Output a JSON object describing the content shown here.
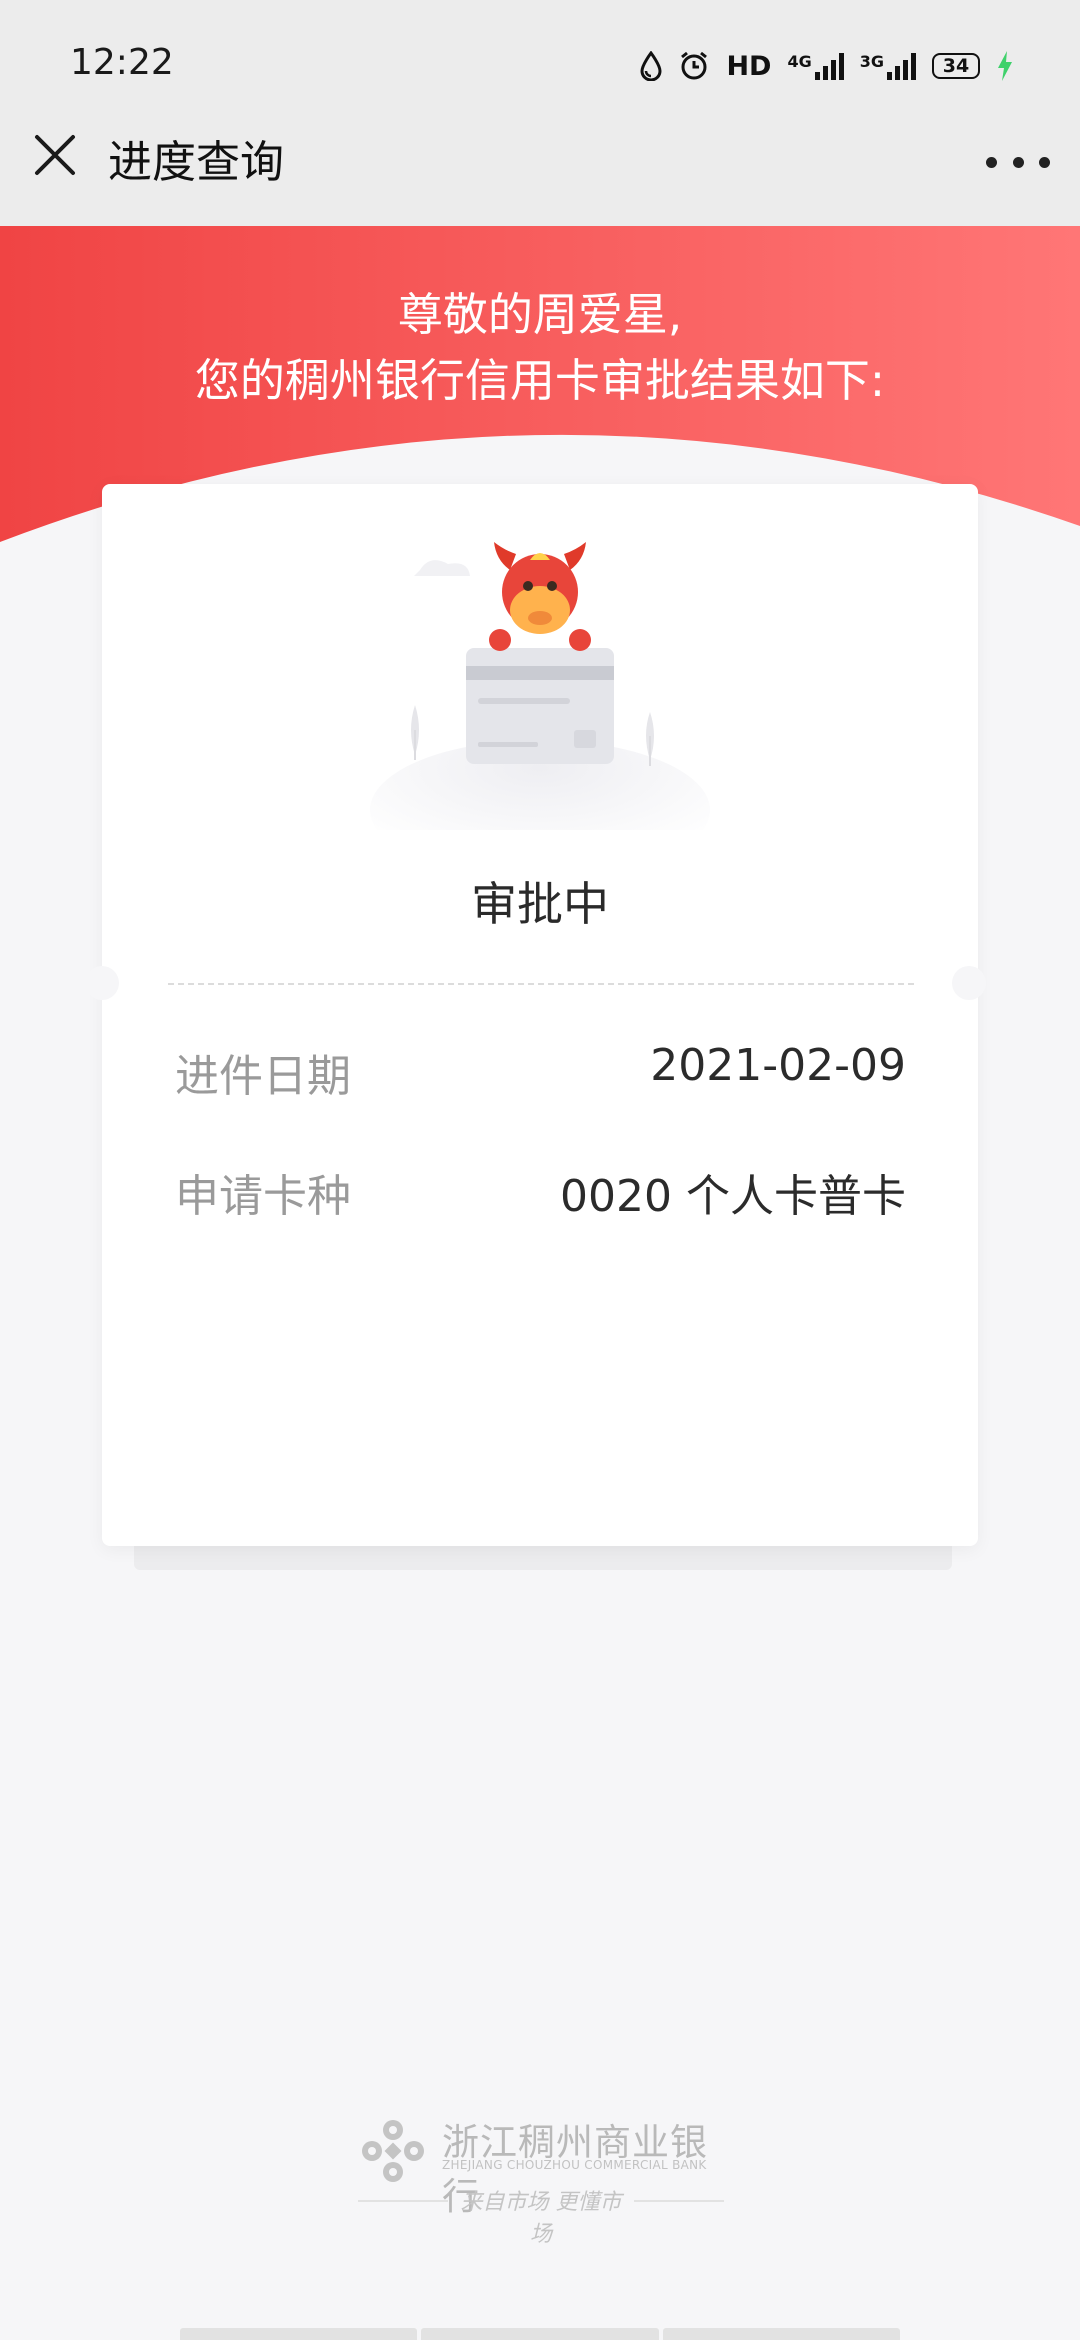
{
  "status_bar": {
    "time": "12:22",
    "hd_label": "HD",
    "network_1": "4G",
    "network_2": "3G",
    "battery": "34",
    "icons": [
      "water-drop-icon",
      "alarm-icon",
      "signal-icon",
      "charging-icon"
    ]
  },
  "nav": {
    "title": "进度查询",
    "close_icon": "close-icon",
    "more_icon": "more-icon"
  },
  "header": {
    "greeting_line1": "尊敬的周爱星,",
    "greeting_line2": "您的稠州银行信用卡审批结果如下:"
  },
  "result": {
    "status": "审批中",
    "rows": [
      {
        "label": "进件日期",
        "value": "2021-02-09"
      },
      {
        "label": "申请卡种",
        "value": "0020 个人卡普卡"
      }
    ]
  },
  "footer": {
    "bank_name_cn": "浙江稠州商业银行",
    "bank_name_en": "ZHEJIANG CHOUZHOU COMMERCIAL BANK",
    "slogan": "来自市场 更懂市场"
  },
  "colors": {
    "banner_start": "#f04444",
    "banner_end": "#ff7676",
    "background": "#f6f6f8"
  }
}
